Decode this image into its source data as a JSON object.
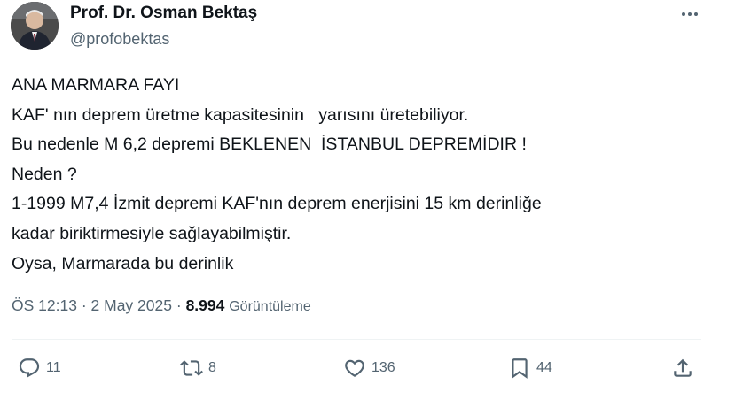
{
  "author": {
    "name": "Prof. Dr. Osman Bektaş",
    "handle": "@profobektas"
  },
  "tweet": {
    "lines": [
      "ANA MARMARA FAYI",
      "KAF' nın deprem üretme kapasitesinin   yarısını üretebiliyor.",
      "Bu nedenle M 6,2 depremi BEKLENEN  İSTANBUL DEPREMİDIR !",
      "Neden ?",
      "1-1999 M7,4 İzmit depremi KAF'nın deprem enerjisini 15 km derinliğe",
      "kadar biriktirmesiyle sağlayabilmiştir.",
      "Oysa, Marmarada bu derinlik"
    ]
  },
  "meta": {
    "time": "ÖS 12:13",
    "separator": "·",
    "date": "2 May 2025",
    "views_count": "8.994",
    "views_label": "Görüntüleme"
  },
  "actions": {
    "reply": {
      "icon": "reply-icon",
      "count": "11"
    },
    "retweet": {
      "icon": "retweet-icon",
      "count": "8"
    },
    "like": {
      "icon": "heart-icon",
      "count": "136"
    },
    "bookmark": {
      "icon": "bookmark-icon",
      "count": "44"
    },
    "share": {
      "icon": "share-icon"
    }
  },
  "colors": {
    "text": "#0f1419",
    "secondary": "#536471",
    "divider": "#eff3f4"
  }
}
